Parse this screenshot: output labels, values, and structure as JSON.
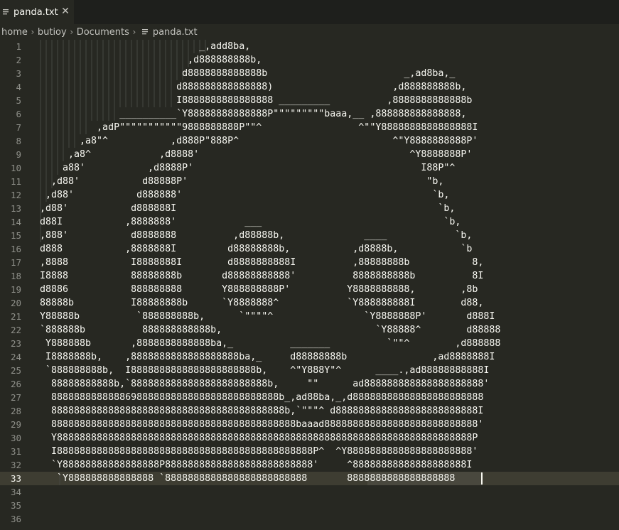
{
  "tab": {
    "label": "panda.txt",
    "close_glyph": "✕",
    "icon": "file-lines-icon"
  },
  "breadcrumb": {
    "items": [
      "home",
      "butioy",
      "Documents"
    ],
    "file_label": "panda.txt",
    "separator_icon": "chevron-right-icon"
  },
  "editor": {
    "current_line": 33,
    "selected_text": "8888888888888888888",
    "lines": [
      "                            _,add8ba,",
      "                          ,d888888888b,",
      "                         d8888888888888b                        _,ad8ba,_",
      "                        d888888888888888)                     ,d888888888b,",
      "                        I8888888888888888 _________          ,8888888888888b",
      "              __________`Y88888888888888P\"\"\"\"\"\"\"\"\"baaa,__ ,888888888888888,",
      "          ,adP\"\"\"\"\"\"\"\"\"\"\"9888888888P\"\"^                 ^\"\"Y8888888888888888I",
      "       ,a8\"^           ,d888P\"888P^                           ^\"Y8888888888P'",
      "     ,a8^            ,d8888'                                     ^Y8888888P'",
      "    a88'           ,d8888P'                                        I88P\"^",
      "  ,d88'           d88888P'                                          \"b,",
      " ,d88'           d888888'                                            `b,",
      ",d88'           d888888I                                              `b,",
      "d88I           ,8888888'            ___                                `b,",
      ",888'           d8888888          ,d88888b,              ____            `b,",
      "d888           ,8888888I         d88888888b,           ,d8888b,           `b",
      ",8888           I8888888I        d8888888888I          ,88888888b           8,",
      "I8888           88888888b       d88888888888'          8888888888b          8I",
      "d8886           888888888       Y888888888P'          Y8888888888,        ,8b",
      "88888b          I88888888b      `Y8888888^            `Y888888888I        d88,",
      "Y88888b          `888888888b,      `\"\"\"\"^                `Y8888888P'       d888I",
      "`888888b          888888888888b,                           `Y88888^        d88888",
      " Y888888b       ,8888888888888ba,_          _______          `\"\"^        ,d888888",
      " I8888888b,    ,8888888888888888888ba,_     d88888888b               ,ad8888888I",
      " `888888888b,  I8888888888888888888888b,    ^\"Y888Y\"^      ____.,ad88888888888I",
      "  88888888888b,`888888888888888888888888b,     \"\"      ad888888888888888888888'",
      "  8888888888888698888888888888888888888888b_,ad88ba,_,d88888888888888888888888",
      "  88888888888888888888888888888888888888888b,`\"\"\"^ d8888888888888888888888888I",
      "  8888888888888888888888888888888888888888888baaad888888888888888888888888888'",
      "  Y8888888888888888888888888888888888888888888888888888888888888888888888888P",
      "  I888888888888888888888888888888888888888888888P^  ^Y8888888888888888888888'",
      "  `Y88888888888888888P88888888888888888888888888'     ^88888888888888888888I",
      "   `Y888888888888888 `8888888888888888888888888       8888888888888888888",
      "",
      "",
      ""
    ]
  }
}
